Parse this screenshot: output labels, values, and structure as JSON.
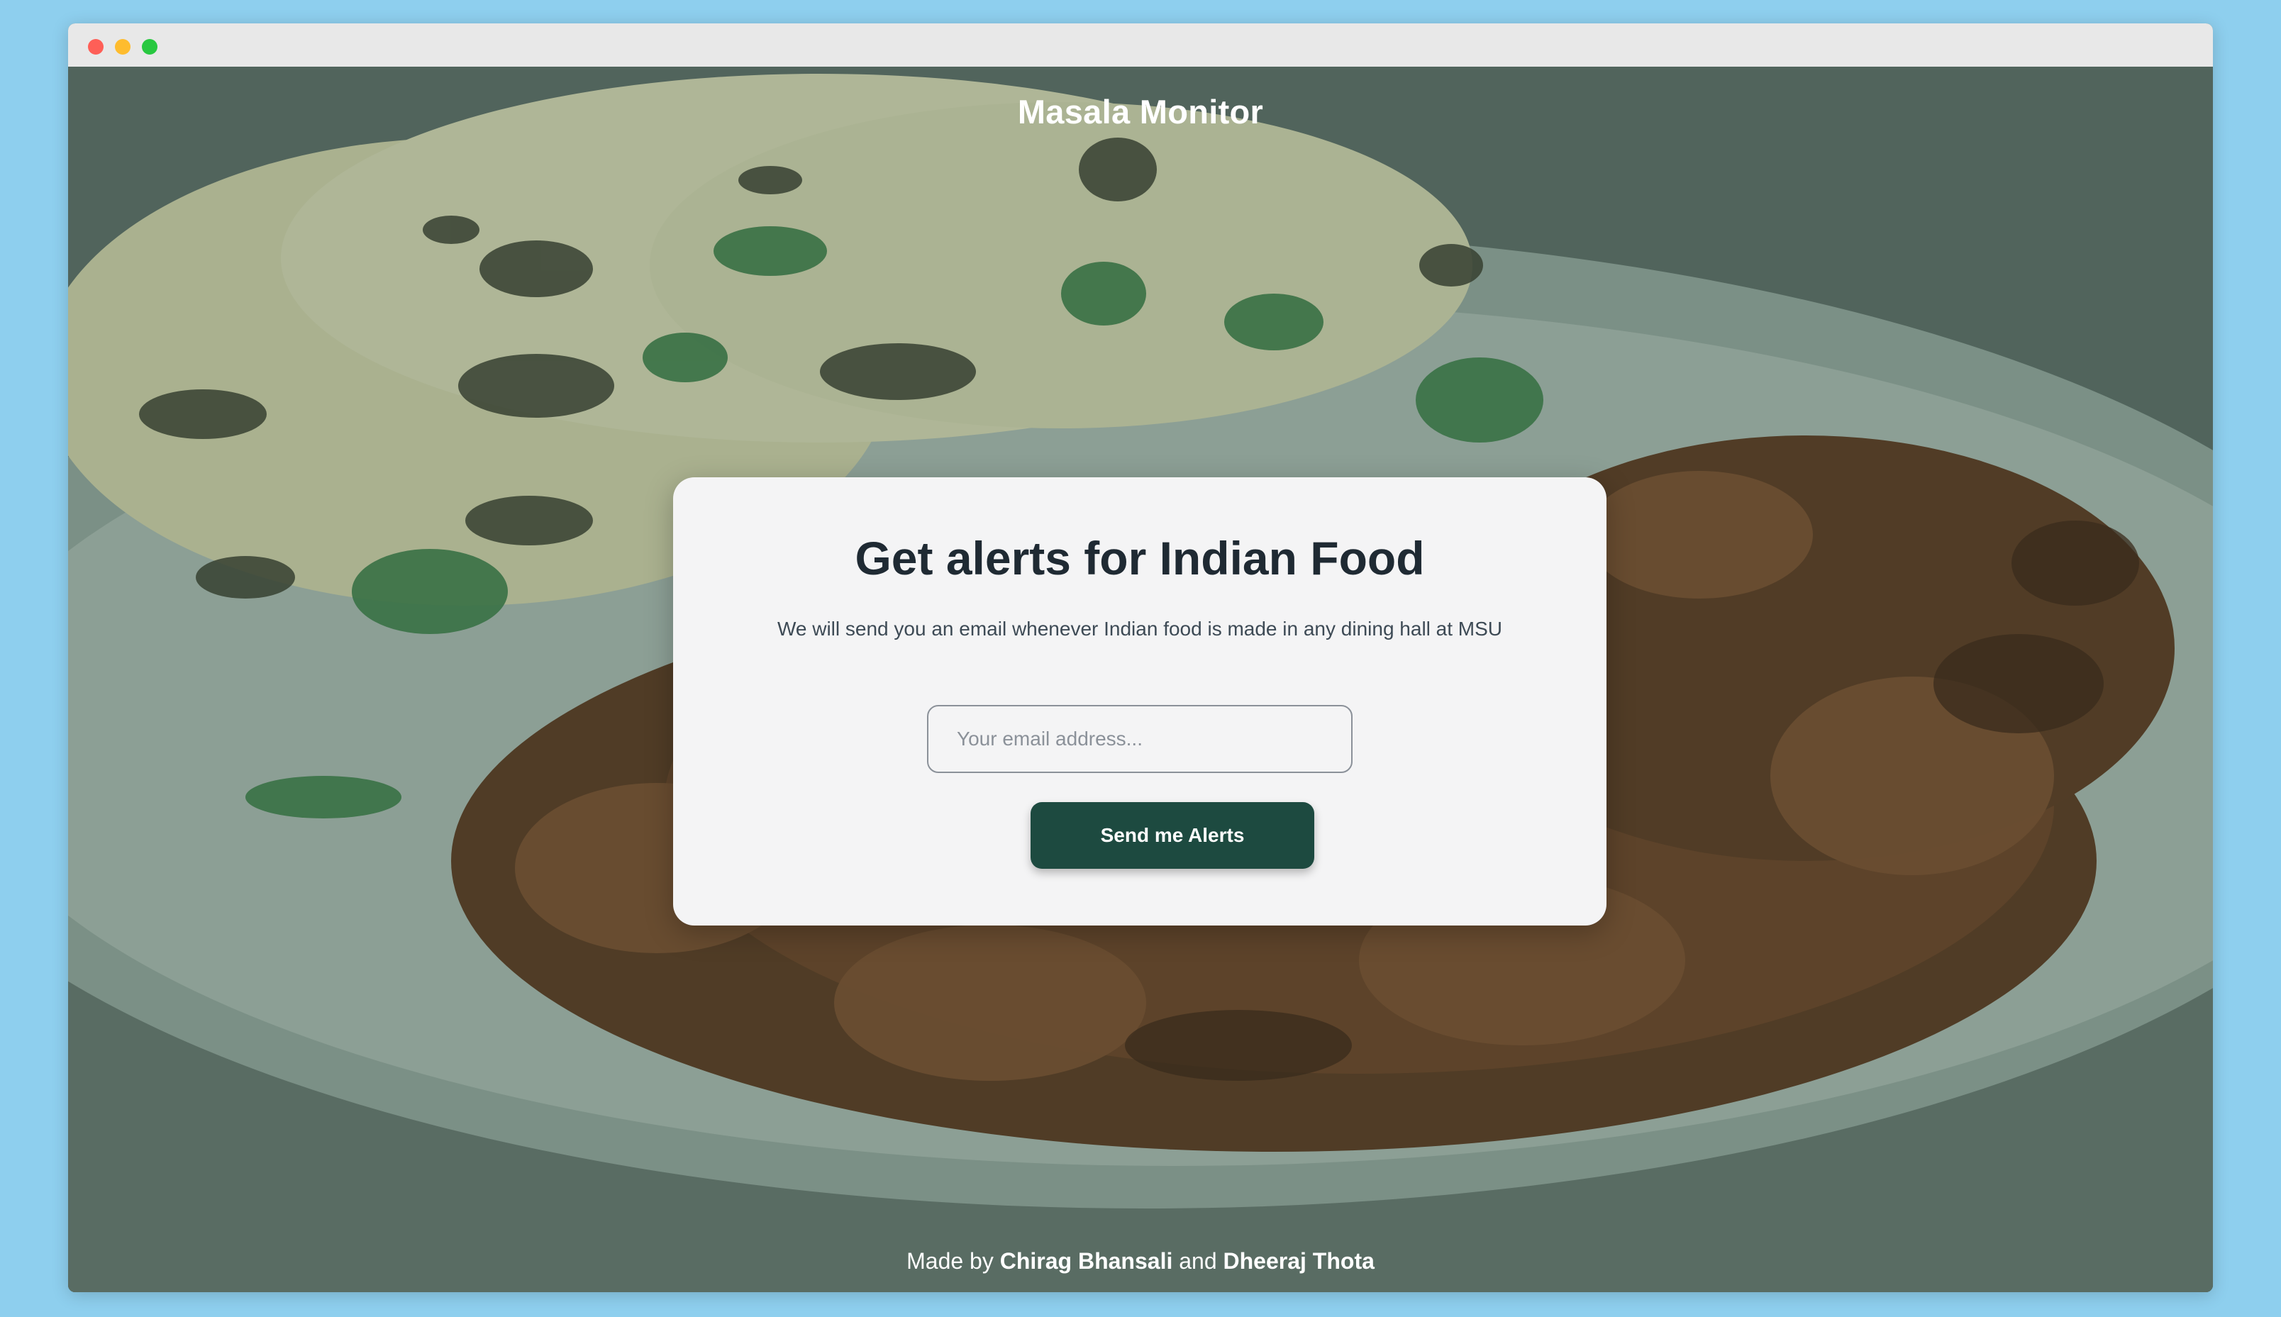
{
  "app": {
    "brand_title": "Masala Monitor"
  },
  "card": {
    "heading": "Get alerts for Indian Food",
    "subtitle": "We will send you an email whenever Indian food is made in any dining hall at MSU",
    "email_placeholder": "Your email address...",
    "email_value": "",
    "submit_label": "Send me Alerts"
  },
  "footer": {
    "made_by": "Made by",
    "author1": "Chirag Bhansali",
    "and": "and",
    "author2": "Dheeraj Thota"
  },
  "colors": {
    "page_background": "#8ecfee",
    "card_background": "#f4f4f5",
    "button_background": "#1d4a40",
    "heading_text": "#1f2a33"
  },
  "icons": {
    "window_controls": [
      "close-dot-icon",
      "minimize-dot-icon",
      "zoom-dot-icon"
    ],
    "hero_image": "naan-and-curry-plate-photo"
  }
}
